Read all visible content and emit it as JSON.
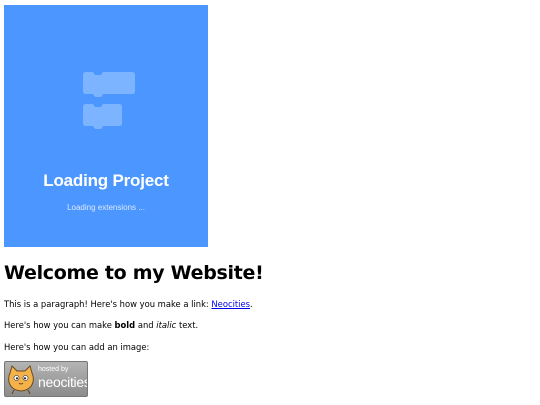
{
  "loader": {
    "title": "Loading Project",
    "subtitle": "Loading extensions ...",
    "background_color": "#4c97ff",
    "icon": "scratch-blocks-icon"
  },
  "content": {
    "heading": "Welcome to my Website!",
    "paragraph1": {
      "before": "This is a paragraph! Here's how you make a link: ",
      "link_text": "Neocities",
      "after": "."
    },
    "paragraph2": {
      "before": "Here's how you can make ",
      "bold": "bold",
      "middle": " and ",
      "italic": "italic",
      "after": " text."
    },
    "paragraph3": "Here's how you can add an image:",
    "link_color": "#0000ee"
  },
  "badge": {
    "hosted_text": "hosted by",
    "brand_text": "neocities",
    "icon": "neocities-cat-icon"
  }
}
